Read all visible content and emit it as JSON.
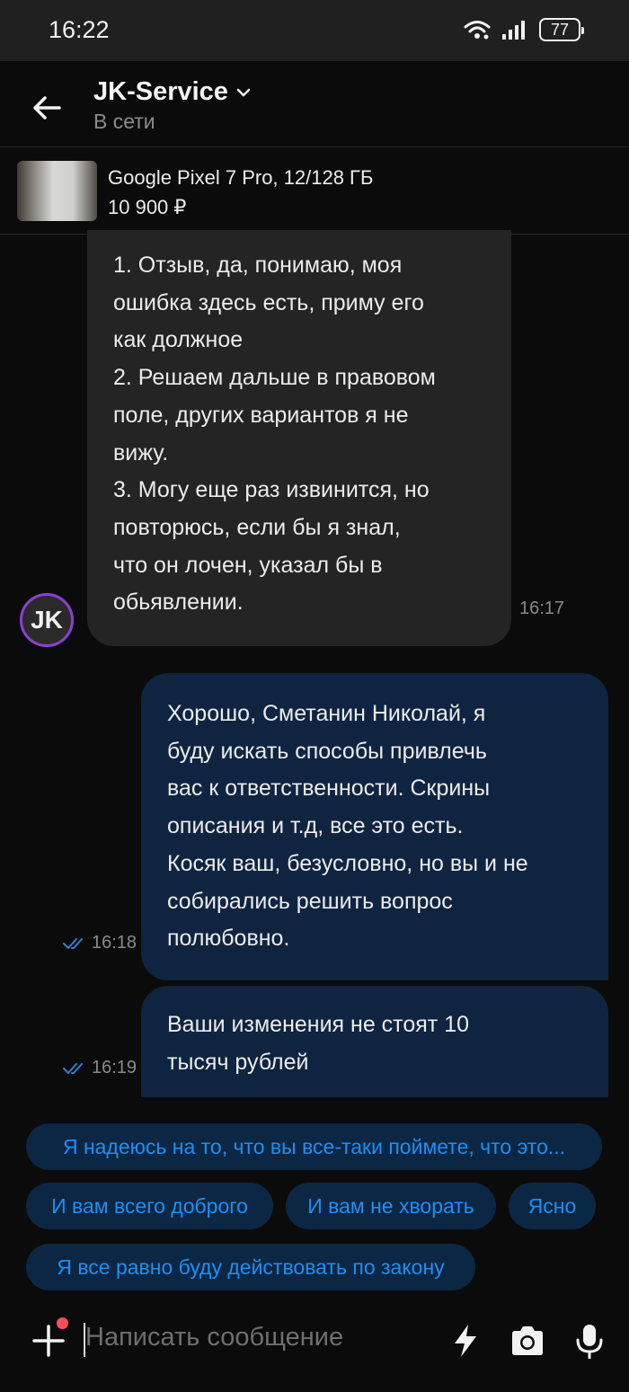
{
  "status_bar": {
    "time": "16:22",
    "battery": "77"
  },
  "header": {
    "name": "JK-Service",
    "status": "В сети"
  },
  "product": {
    "title": "Google Pixel 7 Pro, 12/128 ГБ",
    "price": "10 900 ₽"
  },
  "messages": [
    {
      "direction": "incoming",
      "lines": [
        "1. Отзыв, да, понимаю, моя",
        "ошибка здесь есть, приму его",
        "как должное",
        "2. Решаем дальше в правовом",
        "поле, других вариантов я не",
        "вижу.",
        "3. Могу еще раз извинится, но",
        "повторюсь, если бы я знал,",
        "что он лочен, указал бы в",
        "обьявлении."
      ],
      "time": "16:17",
      "avatar": "JK"
    },
    {
      "direction": "outgoing",
      "lines": [
        "Хорошо, Сметанин Николай, я",
        "буду искать способы привлечь",
        "вас к ответственности. Скрины",
        "описания и т.д, все это есть.",
        "Косяк ваш, безусловно, но вы и не",
        "собирались решить вопрос",
        "полюбовно."
      ],
      "time": "16:18"
    },
    {
      "direction": "outgoing",
      "lines": [
        "Ваши изменения не стоят 10",
        "тысяч рублей"
      ],
      "time": "16:19"
    }
  ],
  "quick_replies": [
    "Я надеюсь на то, что вы все-таки поймете, что это...",
    "И вам всего доброго",
    "И вам не хворать",
    "Ясно",
    "Я все равно буду действовать по закону"
  ],
  "input": {
    "placeholder": "Написать сообщение"
  },
  "colors": {
    "background": "#0b0b0b",
    "incoming_bubble": "#242424",
    "outgoing_bubble": "#0f2440",
    "chip_text": "#1c8ff5",
    "avatar_ring": "#8c3fd0",
    "read_ticks": "#2f7fd6",
    "notification_dot": "#ff4d5a"
  },
  "icons": [
    "wifi-icon",
    "signal-icon",
    "battery-icon",
    "back-arrow-icon",
    "chevron-down-icon",
    "read-ticks-icon",
    "plus-icon",
    "lightning-icon",
    "camera-icon",
    "microphone-icon"
  ]
}
